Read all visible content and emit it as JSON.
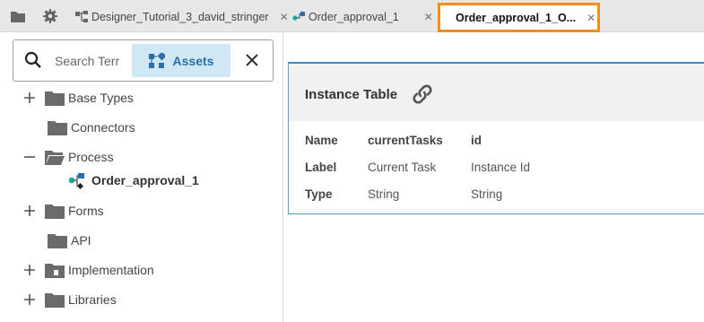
{
  "tabs": {
    "items": [
      {
        "label": "Designer_Tutorial_3_david_stringer",
        "closable": true,
        "icon": "flow-icon"
      },
      {
        "label": "Order_approval_1",
        "closable": true,
        "icon": "process-icon"
      },
      {
        "label": "Order_approval_1_O...",
        "closable": true,
        "icon": "code-file-icon",
        "active": true
      }
    ],
    "close_glyph": "✕"
  },
  "search": {
    "placeholder": "Search Terr",
    "assets_label": "Assets"
  },
  "tree": {
    "items": [
      {
        "label": "Base Types",
        "expander": "+"
      },
      {
        "label": "Connectors",
        "expander": ""
      },
      {
        "label": "Process",
        "expander": "−",
        "open": true
      },
      {
        "label": "Order_approval_1",
        "child": true
      },
      {
        "label": "Forms",
        "expander": "+"
      },
      {
        "label": "API",
        "expander": ""
      },
      {
        "label": "Implementation",
        "expander": "+"
      },
      {
        "label": "Libraries",
        "expander": "+"
      }
    ]
  },
  "instance_table": {
    "title": "Instance Table",
    "rows": [
      [
        "Name",
        "currentTasks",
        "id"
      ],
      [
        "Label",
        "Current Task",
        "Instance Id"
      ],
      [
        "Type",
        "String",
        "String"
      ]
    ]
  },
  "colors": {
    "accent_orange": "#f28c1a",
    "accent_blue": "#2b6fa6",
    "assets_bg": "#cfe8f3"
  }
}
